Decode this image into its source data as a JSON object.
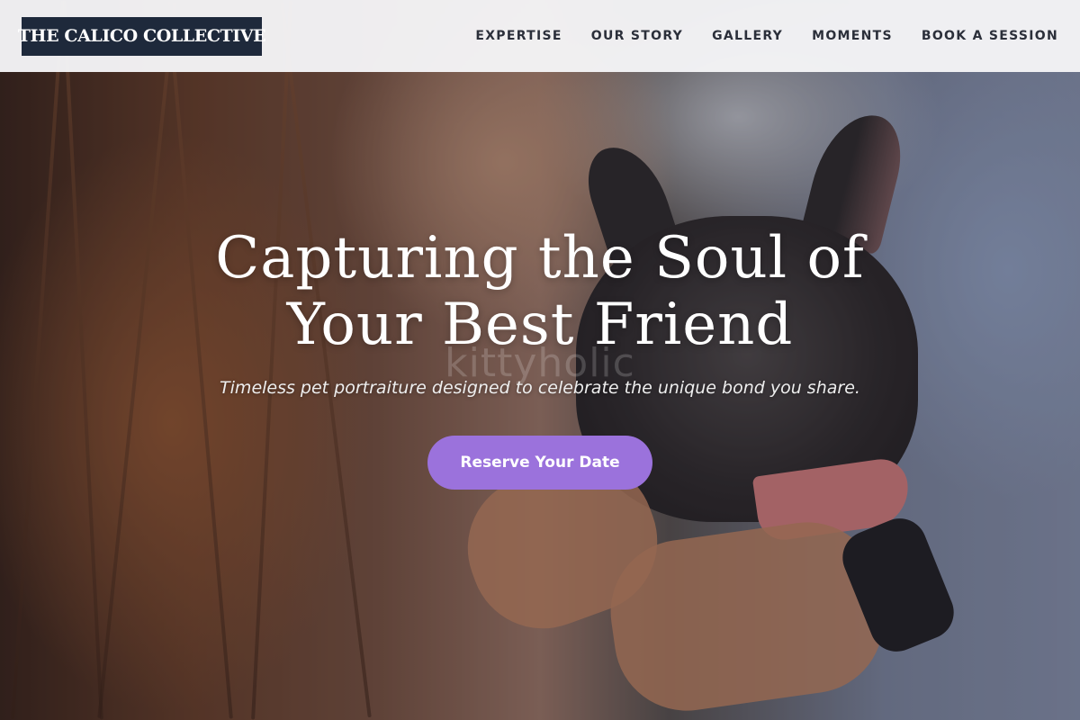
{
  "brand": {
    "logo_text": "THE CALICO COLLECTIVE"
  },
  "nav": {
    "items": [
      {
        "label": "EXPERTISE"
      },
      {
        "label": "OUR STORY"
      },
      {
        "label": "GALLERY"
      },
      {
        "label": "MOMENTS"
      },
      {
        "label": "BOOK A SESSION"
      }
    ]
  },
  "hero": {
    "headline_line1": "Capturing the Soul of",
    "headline_line2": "Your Best Friend",
    "subheadline": "Timeless pet portraiture designed to celebrate the unique bond you share.",
    "cta_label": "Reserve Your Date",
    "watermark": "kittyholic"
  },
  "colors": {
    "logo_bg": "#1e293b",
    "cta_bg": "#9b72dc",
    "nav_text": "#2b2f3a",
    "header_bg": "#f5f5f7"
  }
}
